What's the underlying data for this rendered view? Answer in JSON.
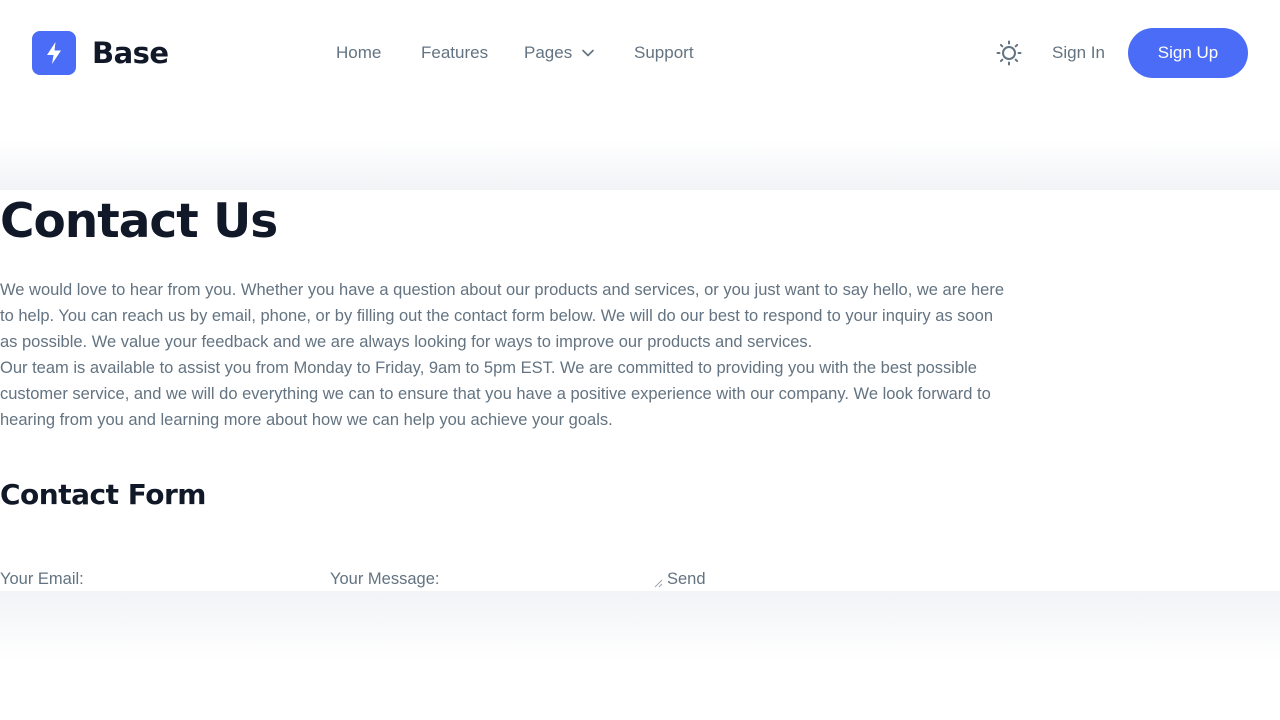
{
  "brand": {
    "name": "Base",
    "logo_icon": "lightning-bolt-icon",
    "accent_color": "#4a6cf7"
  },
  "nav": {
    "home": "Home",
    "features": "Features",
    "pages": "Pages",
    "support": "Support"
  },
  "header": {
    "theme_icon": "sun-icon",
    "sign_in": "Sign In",
    "sign_up": "Sign Up"
  },
  "main": {
    "title": "Contact Us",
    "paragraph_1": "We would love to hear from you. Whether you have a question about our products and services, or you just want to say hello, we are here to help. You can reach us by email, phone, or by filling out the contact form below. We will do our best to respond to your inquiry as soon as possible. We value your feedback and we are always looking for ways to improve our products and services.",
    "paragraph_2": "Our team is available to assist you from Monday to Friday, 9am to 5pm EST. We are committed to providing you with the best possible customer service, and we will do everything we can to ensure that you have a positive experience with our company. We look forward to hearing from you and learning more about how we can help you achieve your goals."
  },
  "contact_form": {
    "title": "Contact Form",
    "email_label": "Your Email:",
    "email_value": "",
    "message_label": "Your Message:",
    "message_value": "",
    "send_label": "Send"
  }
}
